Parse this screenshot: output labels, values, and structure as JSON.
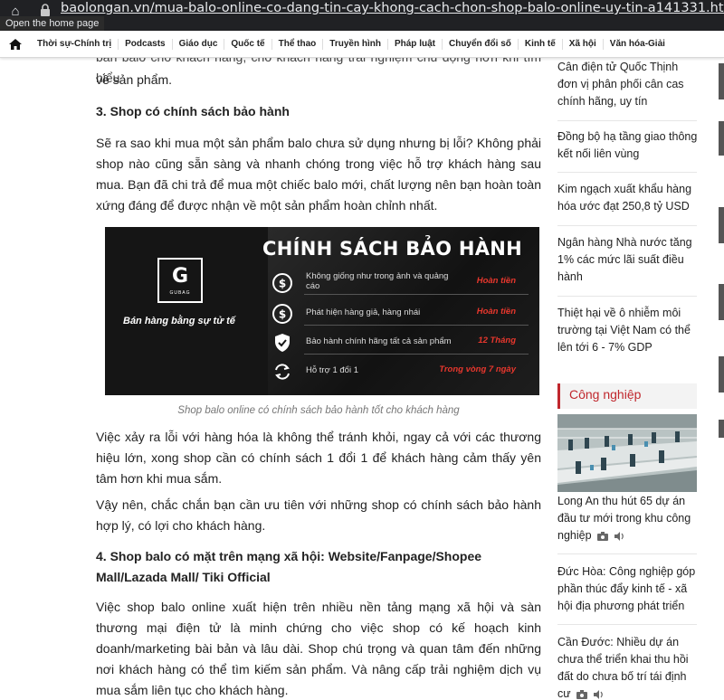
{
  "browser": {
    "url": "baolongan.vn/mua-balo-online-co-dang-tin-cay-khong-cach-chon-shop-balo-online-uy-tin-a141331.html",
    "tooltip": "Open the home page"
  },
  "nav": {
    "items": [
      "Thời sự-Chính trị",
      "Podcasts",
      "Giáo dục",
      "Quốc tế",
      "Thể thao",
      "Truyền hình",
      "Pháp luật",
      "Chuyển đổi số",
      "Kinh tế",
      "Xã hội",
      "Văn hóa-Giải"
    ]
  },
  "article": {
    "cut_line": "bán balo cho khách hàng, cho khách hàng trải nghiệm chủ động hơn khi tìm hiểu",
    "p0_end": "về sản phẩm.",
    "h3": "3. Shop có chính sách bảo hành",
    "p1": "Sẽ ra sao khi mua một sản phẩm balo chưa sử dụng nhưng bị lỗi? Không phải shop nào cũng sẵn sàng và nhanh chóng trong việc hỗ trợ khách hàng sau mua. Bạn đã chi trả để mua một chiếc balo mới, chất lượng nên bạn hoàn toàn xứng đáng để được nhận về một sản phẩm hoàn chỉnh nhất.",
    "banner": {
      "title": "CHÍNH SÁCH BẢO HÀNH",
      "logo_letter": "G",
      "logo_sub": "GUBAG",
      "slogan": "Bán hàng bằng sự tử tế",
      "rows": [
        {
          "text": "Không giống như trong ảnh và quảng cáo",
          "tag": "Hoàn tiền"
        },
        {
          "text": "Phát hiện hàng giả, hàng nhái",
          "tag": "Hoàn tiền"
        },
        {
          "text": "Bảo hành chính hãng tất cả sản phẩm",
          "tag": "12 Tháng"
        },
        {
          "text": "Hỗ trợ 1 đổi 1",
          "tag": "Trong vòng 7 ngày"
        }
      ]
    },
    "caption": "Shop balo online có chính sách bảo hành tốt cho khách hàng",
    "p2": "Việc xảy ra lỗi với hàng hóa là không thể tránh khỏi, ngay cả với các thương hiệu lớn, xong shop cần có chính sách 1 đổi 1 để khách hàng cảm thấy yên tâm hơn khi mua sắm.",
    "p3": "Vậy nên, chắc chắn bạn cần ưu tiên với những shop có chính sách bảo hành hợp lý, có lợi cho khách hàng.",
    "h4": "4. Shop balo có mặt trên mạng xã hội: Website/Fanpage/Shopee Mall/Lazada Mall/ Tiki Official",
    "p4": "Việc shop balo online xuất hiện trên nhiều nền tảng mạng xã hội và sàn thương mại điện tử là minh chứng cho việc shop có kế hoạch kinh doanh/marketing bài bản và lâu dài. Shop chú trọng và quan tâm đến những nơi khách hàng có thể tìm kiếm sản phẩm. Và nâng cấp trải nghiệm dịch vụ mua sắm liên tục cho khách hàng."
  },
  "sidebar": {
    "top_items": [
      "Cân điện tử Quốc Thịnh đơn vị phân phối cân cas chính hãng, uy tín",
      "Đồng bộ hạ tầng giao thông kết nối liên vùng",
      "Kim ngạch xuất khẩu hàng hóa ước đạt 250,8 tỷ USD",
      "Ngân hàng Nhà nước tăng 1% các mức lãi suất điều hành",
      "Thiệt hại về ô nhiễm môi trường tại Việt Nam có thể lên tới 6 - 7% GDP"
    ],
    "section_title": "Công nghiệp",
    "lead": "Long An thu hút 65 dự án đầu tư mới trong khu công nghiệp",
    "items": [
      "Đức Hòa: Công nghiệp góp phần thúc đẩy kinh tế - xã hội địa phương phát triển",
      "Cần Đước: Nhiều dự án chưa thể triển khai thu hồi đất do chưa bố trí tái định cư"
    ]
  }
}
